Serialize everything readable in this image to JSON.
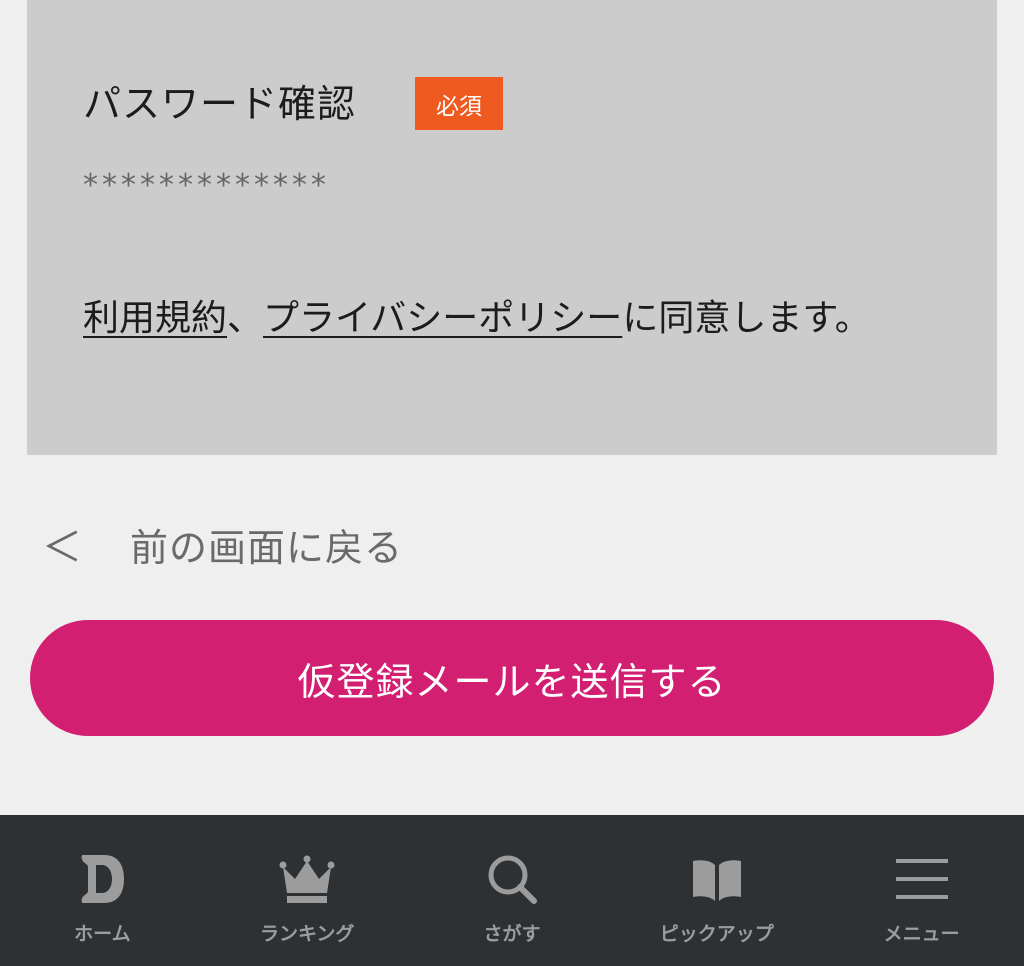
{
  "form": {
    "password_confirm_label": "パスワード確認",
    "required_badge": "必須",
    "password_confirm_value": "*************",
    "consent": {
      "terms_link": "利用規約",
      "separator": "、",
      "privacy_link": "プライバシーポリシー",
      "suffix": "に同意します。"
    }
  },
  "back_link": {
    "icon": "chevron-left-icon",
    "glyph": "＜",
    "label": "前の画面に戻る"
  },
  "submit_button": {
    "label": "仮登録メールを送信する"
  },
  "bottom_nav": {
    "items": [
      {
        "label": "ホーム",
        "icon": "home-logo-icon"
      },
      {
        "label": "ランキング",
        "icon": "crown-icon"
      },
      {
        "label": "さがす",
        "icon": "search-icon"
      },
      {
        "label": "ピックアップ",
        "icon": "book-icon"
      },
      {
        "label": "メニュー",
        "icon": "menu-icon"
      }
    ]
  },
  "colors": {
    "page_background": "#efefef",
    "form_panel": "#cccccc",
    "required_badge": "#ee5a1f",
    "submit_button": "#d31f72",
    "bottom_nav_background": "#2e3134",
    "bottom_nav_icon": "#9c9c9c"
  }
}
